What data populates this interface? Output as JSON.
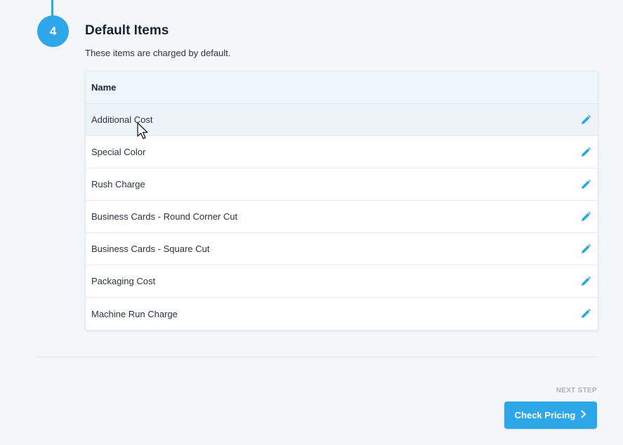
{
  "step": {
    "number": "4",
    "title": "Default Items",
    "description": "These items are charged by default."
  },
  "table": {
    "column_header": "Name",
    "rows": [
      {
        "name": "Additional Cost"
      },
      {
        "name": "Special Color"
      },
      {
        "name": "Rush Charge"
      },
      {
        "name": "Business Cards - Round Corner Cut"
      },
      {
        "name": "Business Cards - Square Cut"
      },
      {
        "name": "Packaging Cost"
      },
      {
        "name": "Machine Run Charge"
      }
    ],
    "row_icon": "pencil-edit-icon"
  },
  "footer": {
    "next_step_label": "NEXT STEP",
    "next_button_label": "Check Pricing",
    "next_button_icon": "chevron-right-icon"
  },
  "colors": {
    "accent": "#2ea7e8",
    "background": "#f4f7f9",
    "header_bg": "#eef7fc",
    "hover_row_bg": "#eef3f7"
  }
}
